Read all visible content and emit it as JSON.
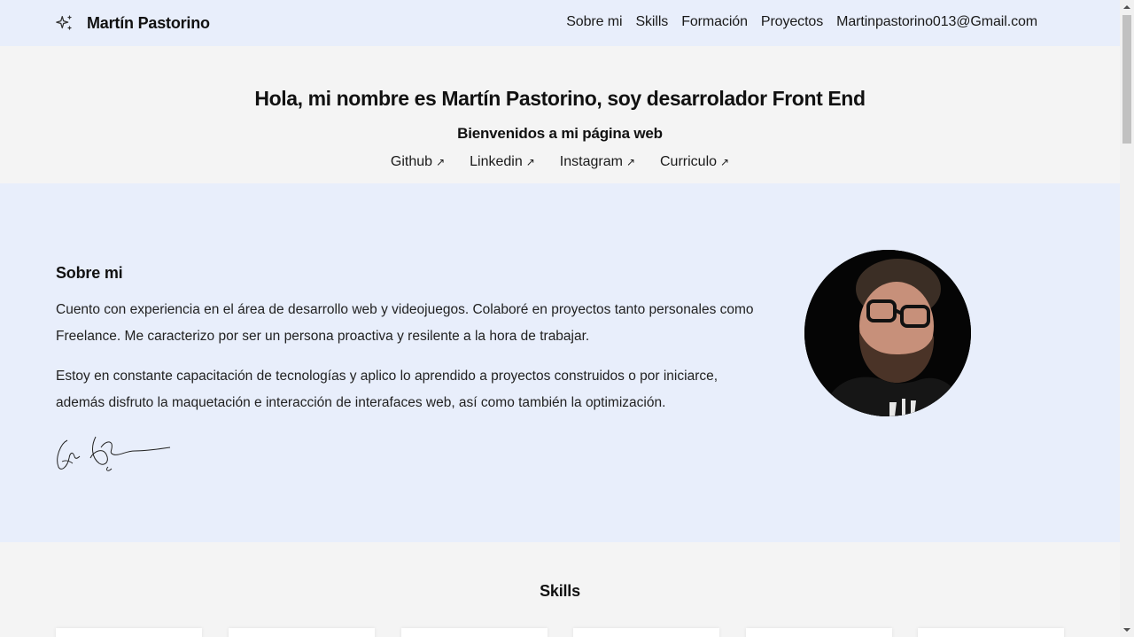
{
  "nav": {
    "brand": "Martín Pastorino",
    "links": [
      "Sobre mi",
      "Skills",
      "Formación",
      "Proyectos",
      "Martinpastorino013@Gmail.com"
    ]
  },
  "hero": {
    "title": "Hola, mi nombre es Martín Pastorino, soy desarrolador Front End",
    "subtitle": "Bienvenidos a mi página web",
    "links": [
      "Github",
      "Linkedin",
      "Instagram",
      "Curriculo"
    ],
    "link_arrow": "↗"
  },
  "about": {
    "heading": "Sobre mi",
    "paragraphs": [
      "Cuento con experiencia en el área de desarrollo web y videojuegos. Colaboré en proyectos tanto personales como Freelance. Me caracterizo por ser un persona proactiva y resilente a la hora de trabajar.",
      "Estoy en constante capacitación de tecnologías y aplico lo aprendido a proyectos construidos o por iniciarce, además disfruto la maquetación e interacción de interafaces web, así como también la optimización."
    ]
  },
  "skills": {
    "heading": "Skills"
  },
  "colors": {
    "nav_bg": "#e8eefb",
    "section_light": "#f4f4f4",
    "section_blue": "#e8eefb",
    "text": "#1a1a1a"
  },
  "icons": {
    "brand": "sparkles-icon",
    "external": "arrow-up-right-icon"
  }
}
